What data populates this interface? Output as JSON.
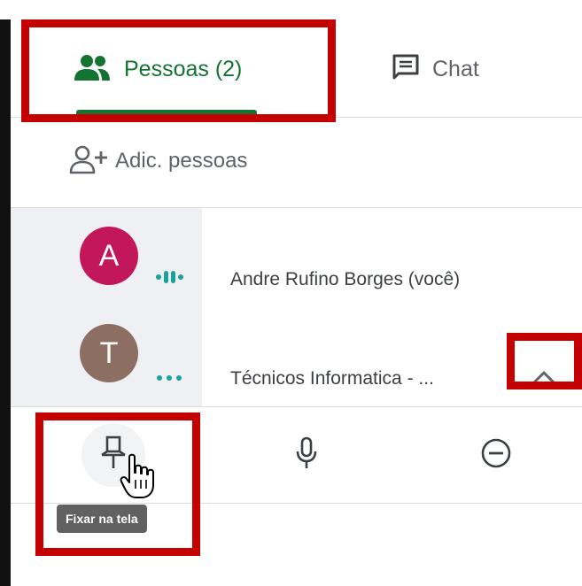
{
  "tabs": {
    "people_label": "Pessoas (2)",
    "chat_label": "Chat"
  },
  "add_people": {
    "label": "Adic. pessoas"
  },
  "participants": [
    {
      "initial": "A",
      "name": "Andre Rufino Borges (você)",
      "avatar_color": "#c2185b",
      "audio": "speaking"
    },
    {
      "initial": "T",
      "name": "Técnicos Informatica - ...",
      "avatar_color": "#8d6e63",
      "audio": "idle"
    }
  ],
  "actions": {
    "pin_icon": "pin-icon",
    "mic_icon": "mic-icon",
    "remove_icon": "remove-icon"
  },
  "tooltip": {
    "text": "Fixar na tela"
  },
  "colors": {
    "accent": "#137333",
    "speaking": "#1aa39c",
    "highlight": "#c40000"
  }
}
